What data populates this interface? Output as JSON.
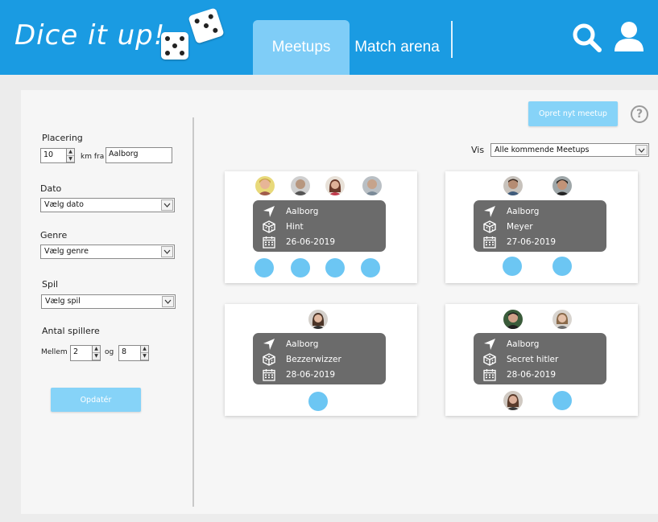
{
  "header": {
    "logo": "Dice it up!",
    "tabs": [
      {
        "label": "Meetups"
      },
      {
        "label": "Match arena"
      }
    ],
    "colors": {
      "bar": "#1a9be2",
      "active_tab": "#7fcdf7"
    },
    "icons": [
      "search-icon",
      "user-icon"
    ]
  },
  "toolbar": {
    "create_button": "Opret nyt meetup",
    "help_icon": "?",
    "filter_label": "Vis",
    "filter_value": "Alle kommende Meetups"
  },
  "sidebar": {
    "location_label": "Placering",
    "distance_value": "10",
    "distance_unit": "km fra",
    "city_value": "Aalborg",
    "date_label": "Dato",
    "date_value": "Vælg dato",
    "genre_label": "Genre",
    "genre_value": "Vælg genre",
    "game_label": "Spil",
    "game_value": "Vælg spil",
    "players_label": "Antal spillere",
    "between_label": "Mellem",
    "min_players": "2",
    "and_label": "og",
    "max_players": "8",
    "update_button": "Opdatér"
  },
  "meetups": [
    {
      "location": "Aalborg",
      "game": "Hint",
      "date": "26-06-2019",
      "joined": 4,
      "open_slots": 4
    },
    {
      "location": "Aalborg",
      "game": "Meyer",
      "date": "27-06-2019",
      "joined": 2,
      "open_slots": 2
    },
    {
      "location": "Aalborg",
      "game": "Bezzerwizzer",
      "date": "28-06-2019",
      "joined": 1,
      "open_slots": 1
    },
    {
      "location": "Aalborg",
      "game": "Secret hitler",
      "date": "28-06-2019",
      "joined": 3,
      "open_slots": 1
    }
  ]
}
